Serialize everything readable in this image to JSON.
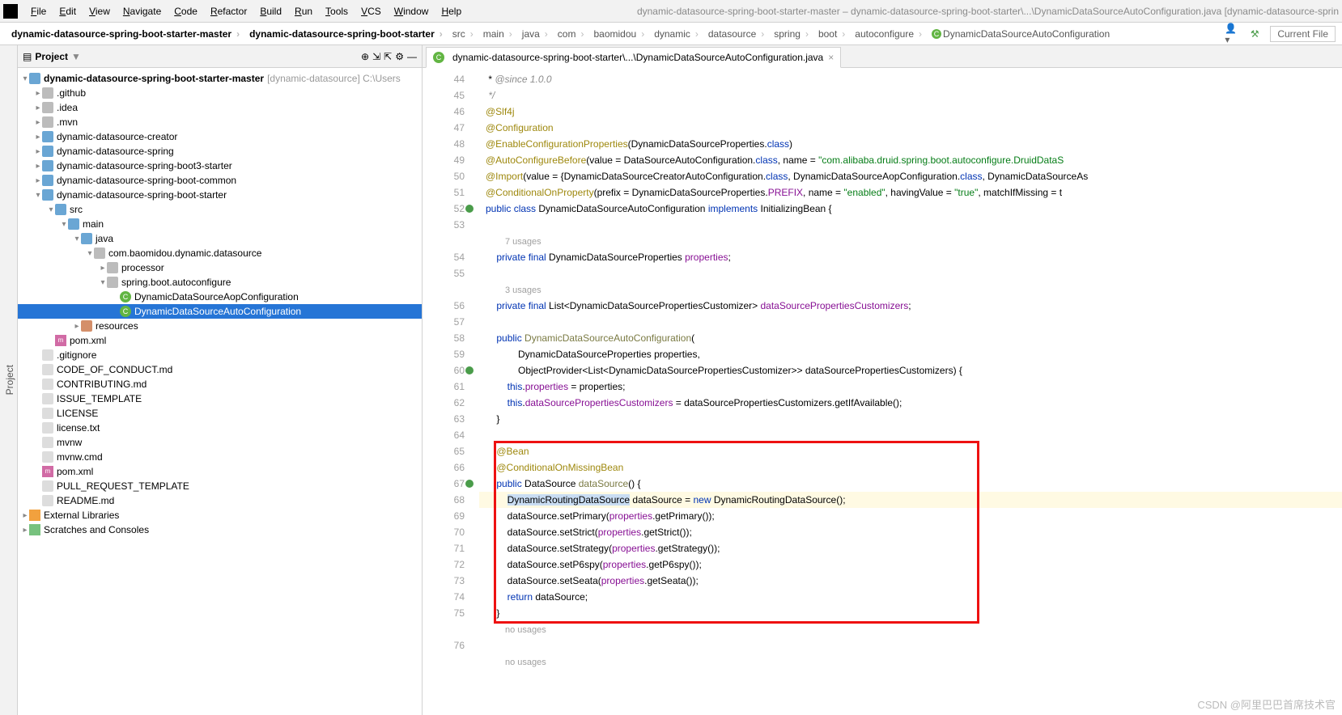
{
  "menubar": {
    "items": [
      "File",
      "Edit",
      "View",
      "Navigate",
      "Code",
      "Refactor",
      "Build",
      "Run",
      "Tools",
      "VCS",
      "Window",
      "Help"
    ],
    "title": "dynamic-datasource-spring-boot-starter-master – dynamic-datasource-spring-boot-starter\\...\\DynamicDataSourceAutoConfiguration.java [dynamic-datasource-sprin"
  },
  "breadcrumbs": [
    "dynamic-datasource-spring-boot-starter-master",
    "dynamic-datasource-spring-boot-starter",
    "src",
    "main",
    "java",
    "com",
    "baomidou",
    "dynamic",
    "datasource",
    "spring",
    "boot",
    "autoconfigure",
    "DynamicDataSourceAutoConfiguration"
  ],
  "navright": {
    "current_file": "Current File"
  },
  "project": {
    "title": "Project",
    "root": {
      "name": "dynamic-datasource-spring-boot-starter-master",
      "hint": "[dynamic-datasource]",
      "path": "C:\\Users"
    },
    "nodes": [
      {
        "d": 1,
        "t": "f",
        "n": ".github",
        "e": ">"
      },
      {
        "d": 1,
        "t": "f",
        "n": ".idea",
        "e": ">"
      },
      {
        "d": 1,
        "t": "f",
        "n": ".mvn",
        "e": ">"
      },
      {
        "d": 1,
        "t": "m",
        "n": "dynamic-datasource-creator",
        "e": ">"
      },
      {
        "d": 1,
        "t": "m",
        "n": "dynamic-datasource-spring",
        "e": ">"
      },
      {
        "d": 1,
        "t": "m",
        "n": "dynamic-datasource-spring-boot3-starter",
        "e": ">"
      },
      {
        "d": 1,
        "t": "m",
        "n": "dynamic-datasource-spring-boot-common",
        "e": ">"
      },
      {
        "d": 1,
        "t": "m",
        "n": "dynamic-datasource-spring-boot-starter",
        "e": "v"
      },
      {
        "d": 2,
        "t": "fb",
        "n": "src",
        "e": "v"
      },
      {
        "d": 3,
        "t": "fb",
        "n": "main",
        "e": "v"
      },
      {
        "d": 4,
        "t": "fb",
        "n": "java",
        "e": "v"
      },
      {
        "d": 5,
        "t": "p",
        "n": "com.baomidou.dynamic.datasource",
        "e": "v"
      },
      {
        "d": 6,
        "t": "p",
        "n": "processor",
        "e": ">"
      },
      {
        "d": 6,
        "t": "p",
        "n": "spring.boot.autoconfigure",
        "e": "v"
      },
      {
        "d": 7,
        "t": "c",
        "n": "DynamicDataSourceAopConfiguration"
      },
      {
        "d": 7,
        "t": "c",
        "n": "DynamicDataSourceAutoConfiguration",
        "sel": true
      },
      {
        "d": 4,
        "t": "fr",
        "n": "resources",
        "e": ">"
      },
      {
        "d": 2,
        "t": "mv",
        "n": "pom.xml"
      },
      {
        "d": 1,
        "t": "x",
        "n": ".gitignore"
      },
      {
        "d": 1,
        "t": "x",
        "n": "CODE_OF_CONDUCT.md"
      },
      {
        "d": 1,
        "t": "x",
        "n": "CONTRIBUTING.md"
      },
      {
        "d": 1,
        "t": "x",
        "n": "ISSUE_TEMPLATE"
      },
      {
        "d": 1,
        "t": "x",
        "n": "LICENSE"
      },
      {
        "d": 1,
        "t": "x",
        "n": "license.txt"
      },
      {
        "d": 1,
        "t": "x",
        "n": "mvnw"
      },
      {
        "d": 1,
        "t": "x",
        "n": "mvnw.cmd"
      },
      {
        "d": 1,
        "t": "mv",
        "n": "pom.xml"
      },
      {
        "d": 1,
        "t": "x",
        "n": "PULL_REQUEST_TEMPLATE"
      },
      {
        "d": 1,
        "t": "x",
        "n": "README.md"
      }
    ],
    "extlib": "External Libraries",
    "scratch": "Scratches and Consoles"
  },
  "editor_tab": "dynamic-datasource-spring-boot-starter\\...\\DynamicDataSourceAutoConfiguration.java",
  "code": {
    "start": 44,
    "hints": {
      "54": "7 usages",
      "56": "3 usages",
      "76": "no usages"
    },
    "gutter_icons": {
      "52": "impl",
      "59": "override",
      "65": "override"
    },
    "lines": [
      " * <span class='c-cmt'>@since</span><span class='c-cmt'> 1.0.0</span>",
      " <span class='c-cmt'>*/</span>",
      "<span class='c-ann'>@Slf4j</span>",
      "<span class='c-ann'>@Configuration</span>",
      "<span class='c-ann'>@EnableConfigurationProperties</span>(DynamicDataSourceProperties.<span class='c-kw'>class</span>)",
      "<span class='c-ann'>@AutoConfigureBefore</span>(value = DataSourceAutoConfiguration.<span class='c-kw'>class</span>, name = <span class='c-str'>\"com.alibaba.druid.spring.boot.autoconfigure.DruidDataS</span>",
      "<span class='c-ann'>@Import</span>(value = {DynamicDataSourceCreatorAutoConfiguration.<span class='c-kw'>class</span>, DynamicDataSourceAopConfiguration.<span class='c-kw'>class</span>, DynamicDataSourceAs",
      "<span class='c-ann'>@ConditionalOnProperty</span>(prefix = DynamicDataSourceProperties.<span class='c-fld'>PREFIX</span>, name = <span class='c-str'>\"enabled\"</span>, havingValue = <span class='c-str'>\"true\"</span>, matchIfMissing = t",
      "<span class='c-kw'>public class</span> DynamicDataSourceAutoConfiguration <span class='c-kw'>implements</span> InitializingBean {",
      "",
      "    <span class='c-kw'>private final</span> DynamicDataSourceProperties <span class='c-fld'>properties</span>;",
      "",
      "    <span class='c-kw'>private final</span> List&lt;DynamicDataSourcePropertiesCustomizer&gt; <span class='c-fld'>dataSourcePropertiesCustomizers</span>;",
      "",
      "    <span class='c-kw'>public</span> <span class='c-mtd'>DynamicDataSourceAutoConfiguration</span>(",
      "            DynamicDataSourceProperties properties,",
      "            ObjectProvider&lt;List&lt;DynamicDataSourcePropertiesCustomizer&gt;&gt; dataSourcePropertiesCustomizers) {",
      "        <span class='c-kw'>this</span>.<span class='c-fld'>properties</span> = properties;",
      "        <span class='c-kw'>this</span>.<span class='c-fld'>dataSourcePropertiesCustomizers</span> = dataSourcePropertiesCustomizers.getIfAvailable();",
      "    }",
      "",
      "    <span class='c-ann'>@Bean</span>",
      "    <span class='c-ann'>@ConditionalOnMissingBean</span>",
      "    <span class='c-kw'>public</span> DataSource <span class='c-mtd'>dataSource</span>() {",
      "        <span class='badge-sel'>DynamicRoutingDataSource</span> dataSource = <span class='c-kw'>new</span> DynamicRoutingDataSource();",
      "        dataSource.setPrimary(<span class='c-fld'>properties</span>.getPrimary());",
      "        dataSource.setStrict(<span class='c-fld'>properties</span>.getStrict());",
      "        dataSource.setStrategy(<span class='c-fld'>properties</span>.getStrategy());",
      "        dataSource.setP6spy(<span class='c-fld'>properties</span>.getP6spy());",
      "        dataSource.setSeata(<span class='c-fld'>properties</span>.getSeata());",
      "        <span class='c-kw'>return</span> dataSource;",
      "    }",
      ""
    ]
  },
  "watermark": "CSDN @阿里巴巴首席技术官"
}
